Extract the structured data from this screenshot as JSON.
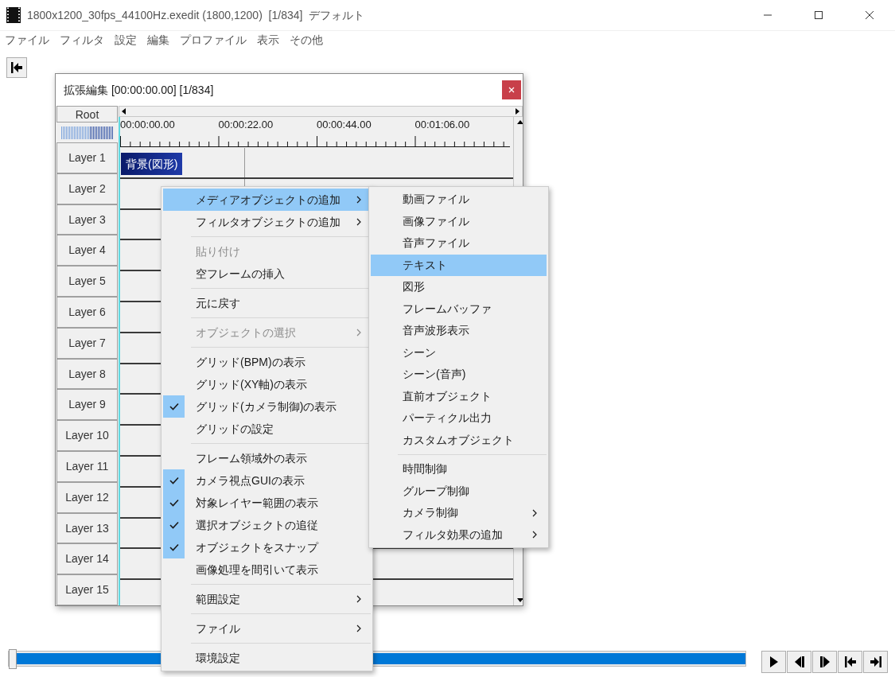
{
  "window": {
    "title": "1800x1200_30fps_44100Hz.exedit (1800,1200)  [1/834]  デフォルト"
  },
  "frame_slider": {
    "level": 0
  },
  "menu_bar": [
    "ファイル",
    "フィルタ",
    "設定",
    "編集",
    "プロファイル",
    "表示",
    "その他"
  ],
  "edit_window": {
    "title": "拡張編集 [00:00:00.00] [1/834]",
    "root_button": "Root",
    "ruler_labels": [
      "00:00:00.00",
      "00:00:22.00",
      "00:00:44.00",
      "00:01:06.00"
    ],
    "layers": [
      {
        "label": "Layer 1",
        "objects": [
          {
            "label": "背景(図形)"
          }
        ]
      },
      {
        "label": "Layer 2"
      },
      {
        "label": "Layer 3"
      },
      {
        "label": "Layer 4"
      },
      {
        "label": "Layer 5"
      },
      {
        "label": "Layer 6"
      },
      {
        "label": "Layer 7"
      },
      {
        "label": "Layer 8"
      },
      {
        "label": "Layer 9"
      },
      {
        "label": "Layer 10"
      },
      {
        "label": "Layer 11"
      },
      {
        "label": "Layer 12"
      },
      {
        "label": "Layer 13"
      },
      {
        "label": "Layer 14"
      },
      {
        "label": "Layer 15"
      }
    ]
  },
  "context_menu": {
    "items": [
      {
        "kind": "item",
        "label": "メディアオブジェクトの追加",
        "selected": true,
        "checked": false,
        "disabled": false,
        "submenu": true
      },
      {
        "kind": "item",
        "label": "フィルタオブジェクトの追加",
        "selected": false,
        "checked": false,
        "disabled": false,
        "submenu": true
      },
      {
        "kind": "separator"
      },
      {
        "kind": "item",
        "label": "貼り付け",
        "selected": false,
        "checked": false,
        "disabled": true,
        "submenu": false
      },
      {
        "kind": "item",
        "label": "空フレームの挿入",
        "selected": false,
        "checked": false,
        "disabled": false,
        "submenu": false
      },
      {
        "kind": "separator"
      },
      {
        "kind": "item",
        "label": "元に戻す",
        "selected": false,
        "checked": false,
        "disabled": false,
        "submenu": false
      },
      {
        "kind": "separator"
      },
      {
        "kind": "item",
        "label": "オブジェクトの選択",
        "selected": false,
        "checked": false,
        "disabled": true,
        "submenu": true
      },
      {
        "kind": "separator"
      },
      {
        "kind": "item",
        "label": "グリッド(BPM)の表示",
        "selected": false,
        "checked": false,
        "disabled": false,
        "submenu": false
      },
      {
        "kind": "item",
        "label": "グリッド(XY軸)の表示",
        "selected": false,
        "checked": false,
        "disabled": false,
        "submenu": false
      },
      {
        "kind": "item",
        "label": "グリッド(カメラ制御)の表示",
        "selected": false,
        "checked": true,
        "disabled": false,
        "submenu": false
      },
      {
        "kind": "item",
        "label": "グリッドの設定",
        "selected": false,
        "checked": false,
        "disabled": false,
        "submenu": false
      },
      {
        "kind": "separator"
      },
      {
        "kind": "item",
        "label": "フレーム領域外の表示",
        "selected": false,
        "checked": false,
        "disabled": false,
        "submenu": false
      },
      {
        "kind": "item",
        "label": "カメラ視点GUIの表示",
        "selected": false,
        "checked": true,
        "disabled": false,
        "submenu": false
      },
      {
        "kind": "item",
        "label": "対象レイヤー範囲の表示",
        "selected": false,
        "checked": true,
        "disabled": false,
        "submenu": false
      },
      {
        "kind": "item",
        "label": "選択オブジェクトの追従",
        "selected": false,
        "checked": true,
        "disabled": false,
        "submenu": false
      },
      {
        "kind": "item",
        "label": "オブジェクトをスナップ",
        "selected": false,
        "checked": true,
        "disabled": false,
        "submenu": false
      },
      {
        "kind": "item",
        "label": "画像処理を間引いて表示",
        "selected": false,
        "checked": false,
        "disabled": false,
        "submenu": false
      },
      {
        "kind": "separator"
      },
      {
        "kind": "item",
        "label": "範囲設定",
        "selected": false,
        "checked": false,
        "disabled": false,
        "submenu": true
      },
      {
        "kind": "separator"
      },
      {
        "kind": "item",
        "label": "ファイル",
        "selected": false,
        "checked": false,
        "disabled": false,
        "submenu": true
      },
      {
        "kind": "separator"
      },
      {
        "kind": "item",
        "label": "環境設定",
        "selected": false,
        "checked": false,
        "disabled": false,
        "submenu": false
      }
    ]
  },
  "submenu": {
    "items": [
      {
        "kind": "item",
        "label": "動画ファイル",
        "selected": false,
        "submenu": false
      },
      {
        "kind": "item",
        "label": "画像ファイル",
        "selected": false,
        "submenu": false
      },
      {
        "kind": "item",
        "label": "音声ファイル",
        "selected": false,
        "submenu": false
      },
      {
        "kind": "item",
        "label": "テキスト",
        "selected": true,
        "submenu": false
      },
      {
        "kind": "item",
        "label": "図形",
        "selected": false,
        "submenu": false
      },
      {
        "kind": "item",
        "label": "フレームバッファ",
        "selected": false,
        "submenu": false
      },
      {
        "kind": "item",
        "label": "音声波形表示",
        "selected": false,
        "submenu": false
      },
      {
        "kind": "item",
        "label": "シーン",
        "selected": false,
        "submenu": false
      },
      {
        "kind": "item",
        "label": "シーン(音声)",
        "selected": false,
        "submenu": false
      },
      {
        "kind": "item",
        "label": "直前オブジェクト",
        "selected": false,
        "submenu": false
      },
      {
        "kind": "item",
        "label": "パーティクル出力",
        "selected": false,
        "submenu": false
      },
      {
        "kind": "item",
        "label": "カスタムオブジェクト",
        "selected": false,
        "submenu": false
      },
      {
        "kind": "separator"
      },
      {
        "kind": "item",
        "label": "時間制御",
        "selected": false,
        "submenu": false
      },
      {
        "kind": "item",
        "label": "グループ制御",
        "selected": false,
        "submenu": false
      },
      {
        "kind": "item",
        "label": "カメラ制御",
        "selected": false,
        "submenu": true
      },
      {
        "kind": "item",
        "label": "フィルタ効果の追加",
        "selected": false,
        "submenu": true
      }
    ]
  }
}
